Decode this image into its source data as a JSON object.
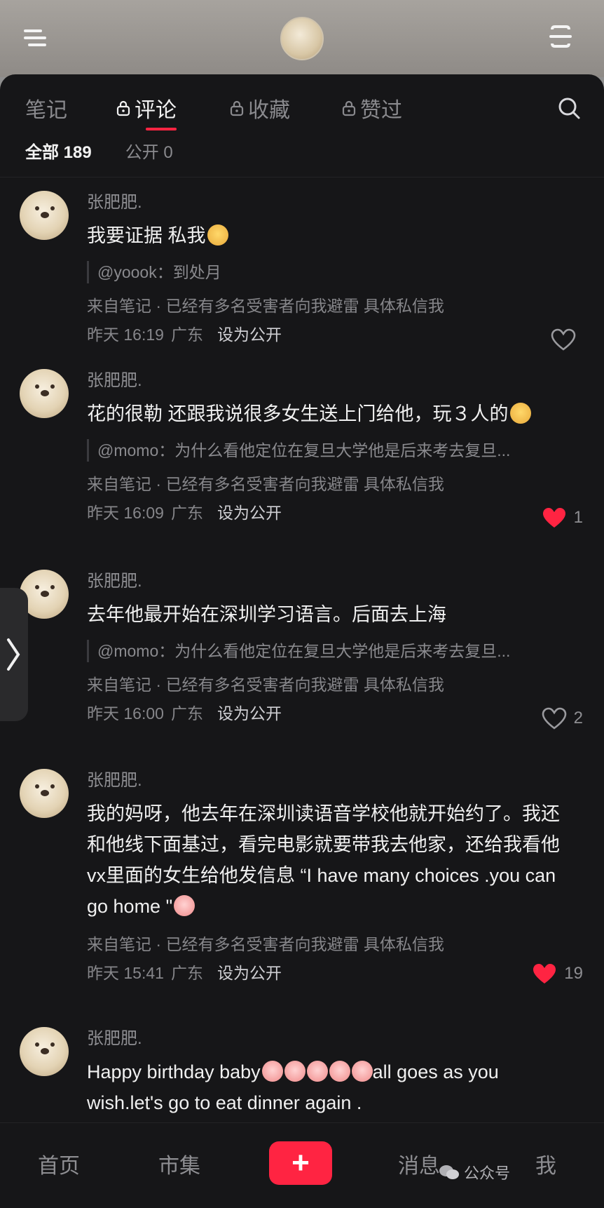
{
  "tabs": [
    {
      "label": "笔记",
      "locked": false
    },
    {
      "label": "评论",
      "locked": true
    },
    {
      "label": "收藏",
      "locked": true
    },
    {
      "label": "赞过",
      "locked": true
    }
  ],
  "subtabs": [
    {
      "label": "全部 189"
    },
    {
      "label": "公开 0"
    }
  ],
  "comments": [
    {
      "name": "张肥肥.",
      "text": "我要证据 私我",
      "quote": "@yoook：到处月",
      "source": "来自笔记 · 已经有多名受害者向我避雷 具体私信我",
      "time": "昨天 16:19",
      "location": "广东",
      "public_label": "设为公开",
      "likes": "",
      "liked": false
    },
    {
      "name": "张肥肥.",
      "text": "花的很勒 还跟我说很多女生送上门给他，玩３人的",
      "quote": "@momo：为什么看他定位在复旦大学他是后来考去复旦...",
      "source": "来自笔记 · 已经有多名受害者向我避雷 具体私信我",
      "time": "昨天 16:09",
      "location": "广东",
      "public_label": "设为公开",
      "likes": "1",
      "liked": true
    },
    {
      "name": "张肥肥.",
      "text": "去年他最开始在深圳学习语言。后面去上海",
      "quote": "@momo：为什么看他定位在复旦大学他是后来考去复旦...",
      "source": "来自笔记 · 已经有多名受害者向我避雷 具体私信我",
      "time": "昨天 16:00",
      "location": "广东",
      "public_label": "设为公开",
      "likes": "2",
      "liked": false
    },
    {
      "name": "张肥肥.",
      "text": "我的妈呀，他去年在深圳读语音学校他就开始约了。我还和他线下面基过，看完电影就要带我去他家，还给我看他vx里面的女生给他发信息 “I have many choices .you can go home \"",
      "source": "来自笔记 · 已经有多名受害者向我避雷 具体私信我",
      "time": "昨天 15:41",
      "location": "广东",
      "public_label": "设为公开",
      "likes": "19",
      "liked": true
    },
    {
      "name": "张肥肥.",
      "text": "Happy birthday baby",
      "text2": "all goes as you wish.let's go to eat dinner again ."
    }
  ],
  "bottom_nav": {
    "home": "首页",
    "market": "市集",
    "add": "+",
    "messages": "消息",
    "me": "我"
  },
  "watermark": "公众号",
  "colors": {
    "accent": "#ff2442",
    "background": "#161618"
  }
}
